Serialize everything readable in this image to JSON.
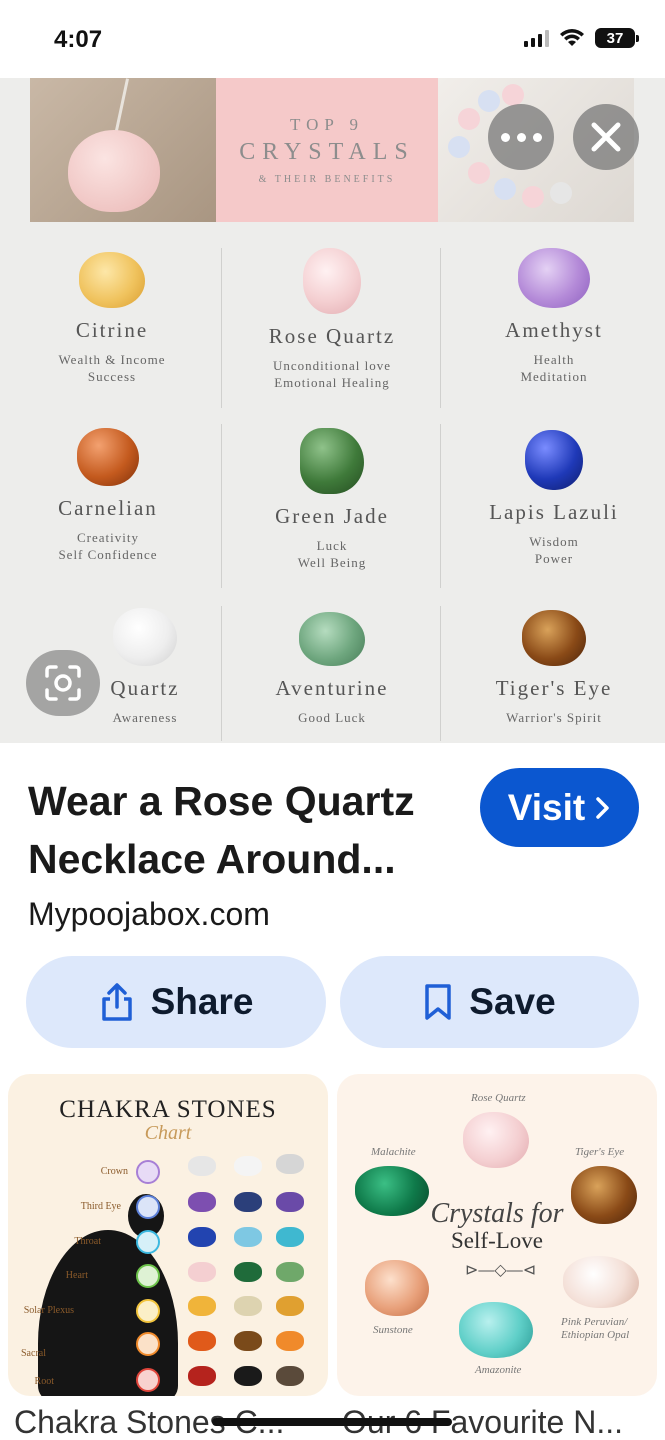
{
  "status_bar": {
    "time": "4:07",
    "battery": "37"
  },
  "hero": {
    "banner": {
      "top": "TOP 9",
      "title": "CRYSTALS",
      "subtitle": "& THEIR BENEFITS"
    },
    "crystals": [
      {
        "name": "Citrine",
        "desc1": "Wealth & Income",
        "desc2": "Success",
        "color": "#f0c35e"
      },
      {
        "name": "Rose Quartz",
        "desc1": "Unconditional love",
        "desc2": "Emotional Healing",
        "color": "#f4cfd1"
      },
      {
        "name": "Amethyst",
        "desc1": "Health",
        "desc2": "Meditation",
        "color": "#b48ad8"
      },
      {
        "name": "Carnelian",
        "desc1": "Creativity",
        "desc2": "Self Confidence",
        "color": "#c45a1e"
      },
      {
        "name": "Green Jade",
        "desc1": "Luck",
        "desc2": "Well Being",
        "color": "#3f7a3a"
      },
      {
        "name": "Lapis Lazuli",
        "desc1": "Wisdom",
        "desc2": "Power",
        "color": "#1f39b8"
      },
      {
        "name": "Quartz",
        "desc1": "Awareness",
        "desc2": "",
        "color": "#f2f2f2"
      },
      {
        "name": "Aventurine",
        "desc1": "Good Luck",
        "desc2": "",
        "color": "#6ea67e"
      },
      {
        "name": "Tiger's Eye",
        "desc1": "Warrior's Spirit",
        "desc2": "",
        "color": "#8a4a17"
      }
    ]
  },
  "pin": {
    "title": "Wear a Rose Quartz Necklace Around...",
    "visit_label": "Visit",
    "source": "Mypoojabox.com",
    "share_label": "Share",
    "save_label": "Save"
  },
  "related": {
    "chakra": {
      "title": "CHAKRA STONES",
      "subtitle": "Chart",
      "labels": [
        "Crown",
        "Third Eye",
        "Throat",
        "Heart",
        "Solar Plexus",
        "Sacral",
        "Root"
      ],
      "colors": [
        "#a77fd6",
        "#5b7fd8",
        "#3bb8e0",
        "#6cc24a",
        "#f2c43d",
        "#f08a2b",
        "#e0453b"
      ],
      "caption": "Chakra Stones C..."
    },
    "selflove": {
      "script_title": "Crystals for",
      "title": "Self-Love",
      "stones": [
        "Rose Quartz",
        "Malachite",
        "Tiger's Eye",
        "Sunstone",
        "Amazonite",
        "Pink Peruvian/ Ethiopian Opal"
      ],
      "caption": "Our 6 Favourite N..."
    }
  }
}
